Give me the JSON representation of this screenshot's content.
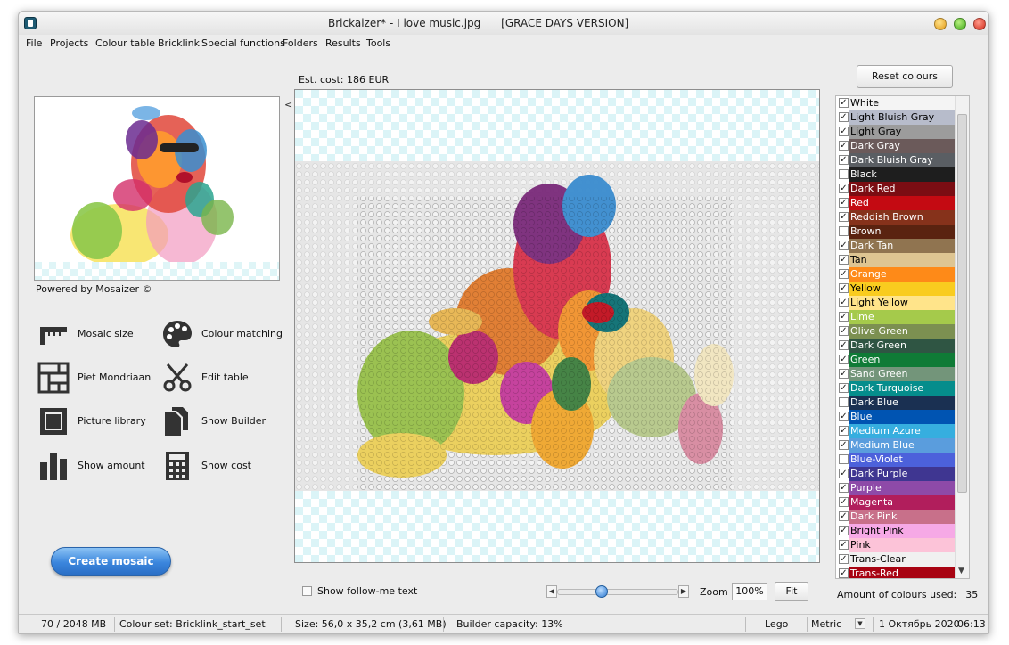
{
  "window": {
    "title": "Brickaizer* - I love music.jpg      [GRACE DAYS VERSION]"
  },
  "menu": [
    "File",
    "Projects",
    "Colour table",
    "Bricklink",
    "Special functions",
    "Folders",
    "Results",
    "Tools"
  ],
  "left_panel": {
    "collapse_arrow": "<",
    "powered_by": "Powered by Mosaizer ©",
    "tools": [
      {
        "label": "Mosaic size",
        "icon": "ruler-icon"
      },
      {
        "label": "Colour matching",
        "icon": "palette-icon"
      },
      {
        "label": "Piet Mondriaan",
        "icon": "grid-icon"
      },
      {
        "label": "Edit table",
        "icon": "scissors-icon"
      },
      {
        "label": "Picture library",
        "icon": "picture-frame-icon"
      },
      {
        "label": "Show Builder",
        "icon": "documents-icon"
      },
      {
        "label": "Show amount",
        "icon": "bar-chart-icon"
      },
      {
        "label": "Show cost",
        "icon": "calculator-icon"
      }
    ],
    "create_button": "Create mosaic"
  },
  "canvas": {
    "est_cost": "Est. cost: 186 EUR"
  },
  "colour_panel": {
    "reset_button": "Reset colours",
    "colours": [
      {
        "name": "White",
        "color": "#f4f4f4",
        "text": "#000000",
        "checked": true
      },
      {
        "name": "Light Bluish Gray",
        "color": "#b7bccb",
        "text": "#000000",
        "checked": true
      },
      {
        "name": "Light Gray",
        "color": "#9c9c9c",
        "text": "#000000",
        "checked": true
      },
      {
        "name": "Dark Gray",
        "color": "#6b5a5a",
        "text": "#ffffff",
        "checked": true
      },
      {
        "name": "Dark Bluish Gray",
        "color": "#5a5e63",
        "text": "#ffffff",
        "checked": true
      },
      {
        "name": "Black",
        "color": "#1e1e1e",
        "text": "#ffffff",
        "checked": false
      },
      {
        "name": "Dark Red",
        "color": "#7b0d13",
        "text": "#ffffff",
        "checked": true
      },
      {
        "name": "Red",
        "color": "#c40a12",
        "text": "#ffffff",
        "checked": true
      },
      {
        "name": "Reddish Brown",
        "color": "#86321b",
        "text": "#ffffff",
        "checked": true
      },
      {
        "name": "Brown",
        "color": "#5a2310",
        "text": "#ffffff",
        "checked": false
      },
      {
        "name": "Dark Tan",
        "color": "#907450",
        "text": "#ffffff",
        "checked": true
      },
      {
        "name": "Tan",
        "color": "#dec592",
        "text": "#000000",
        "checked": true
      },
      {
        "name": "Orange",
        "color": "#fe8a18",
        "text": "#ffffff",
        "checked": true
      },
      {
        "name": "Yellow",
        "color": "#f9cc1f",
        "text": "#000000",
        "checked": true
      },
      {
        "name": "Light Yellow",
        "color": "#ffe48a",
        "text": "#000000",
        "checked": true
      },
      {
        "name": "Lime",
        "color": "#a5ca4b",
        "text": "#ffffff",
        "checked": true
      },
      {
        "name": "Olive Green",
        "color": "#7c9051",
        "text": "#ffffff",
        "checked": true
      },
      {
        "name": "Dark Green",
        "color": "#2f5543",
        "text": "#ffffff",
        "checked": true
      },
      {
        "name": "Green",
        "color": "#0f7b36",
        "text": "#ffffff",
        "checked": true
      },
      {
        "name": "Sand Green",
        "color": "#73957a",
        "text": "#ffffff",
        "checked": true
      },
      {
        "name": "Dark Turquoise",
        "color": "#058d8c",
        "text": "#ffffff",
        "checked": true
      },
      {
        "name": "Dark Blue",
        "color": "#1a3052",
        "text": "#ffffff",
        "checked": false
      },
      {
        "name": "Blue",
        "color": "#0054b2",
        "text": "#ffffff",
        "checked": true
      },
      {
        "name": "Medium Azure",
        "color": "#36aedf",
        "text": "#ffffff",
        "checked": true
      },
      {
        "name": "Medium Blue",
        "color": "#5a9ddd",
        "text": "#ffffff",
        "checked": true
      },
      {
        "name": "Blue-Violet",
        "color": "#4c61db",
        "text": "#ffffff",
        "checked": false
      },
      {
        "name": "Dark Purple",
        "color": "#3f3691",
        "text": "#ffffff",
        "checked": true
      },
      {
        "name": "Purple",
        "color": "#8e4aa8",
        "text": "#ffffff",
        "checked": true
      },
      {
        "name": "Magenta",
        "color": "#b11e5c",
        "text": "#ffffff",
        "checked": true
      },
      {
        "name": "Dark Pink",
        "color": "#c8708a",
        "text": "#ffffff",
        "checked": true
      },
      {
        "name": "Bright Pink",
        "color": "#f6a9e6",
        "text": "#000000",
        "checked": true
      },
      {
        "name": "Pink",
        "color": "#fcc3d8",
        "text": "#000000",
        "checked": true
      },
      {
        "name": "Trans-Clear",
        "color": "#f0f0f0",
        "text": "#000000",
        "checked": true
      },
      {
        "name": "Trans-Red",
        "color": "#a80312",
        "text": "#ffffff",
        "checked": true
      }
    ],
    "amount_label": "Amount of colours used:",
    "amount_value": "35"
  },
  "bottom_bar": {
    "follow_me": "Show follow-me text",
    "zoom_label": "Zoom",
    "zoom_value": "100%",
    "zoom_level": 0.35,
    "fit_button": "Fit"
  },
  "status": {
    "memory": "70 / 2048 MB",
    "colour_set": "Colour set: Bricklink_start_set",
    "size": "Size: 56,0 x 35,2 cm (3,61 MB)",
    "capacity": "Builder capacity: 13%",
    "system": "Lego",
    "units": "Metric",
    "date": "1 Октябрь 2020",
    "time": "06:13"
  }
}
